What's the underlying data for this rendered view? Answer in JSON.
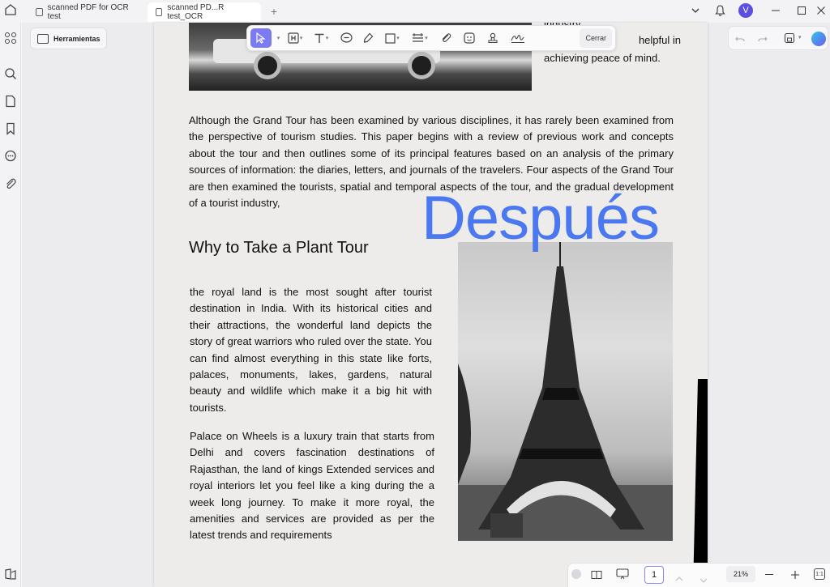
{
  "tabs": [
    {
      "label": "scanned PDF for OCR test",
      "active": false
    },
    {
      "label": "scanned PD...R test_OCR",
      "active": true
    }
  ],
  "user": {
    "initial": "V",
    "color": "#5b4ee0"
  },
  "tools_button": {
    "label": "Herramientas"
  },
  "toolbar": {
    "close_label": "Cerrar",
    "items": [
      "select-cursor-icon",
      "text-box-icon",
      "text-icon",
      "comment-icon",
      "highlighter-icon",
      "rectangle-icon",
      "strikeout-icon",
      "attach-icon",
      "sticker-icon",
      "stamp-icon",
      "signature-icon"
    ],
    "accent": "#7b7bf4"
  },
  "page": {
    "top_right_text_partial": "industry",
    "top_right_line1": "helpful    in",
    "top_right_line2": "achieving peace of mind.",
    "paragraph1": "Although the Grand Tour has been examined by various disciplines, it has rarely been examined from the perspective of tourism studies. This paper begins with a review of previous work and concepts about the tour and then outlines some of its principal features based on an analysis of the primary sources of information: the diaries, letters, and journals of the travelers. Four aspects of the Grand Tour are then examined the tourists, spatial and temporal aspects of the tour, and the gradual development of a tourist industry,",
    "heading": "Why to Take a Plant Tour",
    "paragraph2": "the royal land is the most sought after tourist destination in India. With its historical cities and their attractions, the wonderful land depicts the story of great warriors who ruled over the state. You can find almost everything in this state like forts, palaces, monuments, lakes, gardens, natural beauty and wildlife which make it a big hit with tourists.",
    "paragraph3": "Palace on Wheels is a luxury train that starts from Delhi and covers fascination destinations of Rajasthan, the land of kings Extended services and royal interiors let you feel like a king during the a week long journey. To make it more royal, the amenities and services are provided as per the latest trends and requirements",
    "overlay_text": "Después",
    "overlay_color": "#4a78f0"
  },
  "bottom": {
    "page_number": "1",
    "zoom": "21%"
  }
}
